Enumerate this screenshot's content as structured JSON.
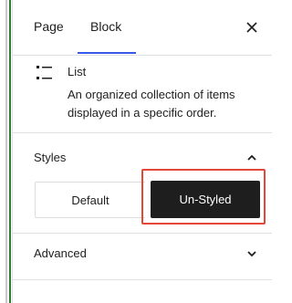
{
  "tabs": [
    {
      "label": "Page",
      "active": false
    },
    {
      "label": "Block",
      "active": true
    }
  ],
  "icons": {
    "close": "close-icon",
    "block": "list-icon",
    "styles_toggle": "chevron-up-icon",
    "advanced_toggle": "chevron-down-icon"
  },
  "block_card": {
    "title": "List",
    "description": "An organized collection of items displayed in a specific order."
  },
  "styles": {
    "title": "Styles",
    "expanded": true,
    "options": [
      {
        "label": "Default",
        "selected": false
      },
      {
        "label": "Un-Styled",
        "selected": true
      }
    ]
  },
  "advanced": {
    "title": "Advanced",
    "expanded": false
  },
  "colors": {
    "accent": "#3858e9",
    "selected_bg": "#1e1e1e",
    "highlight": "#e4473a",
    "edge_green": "#2f7d3a"
  }
}
